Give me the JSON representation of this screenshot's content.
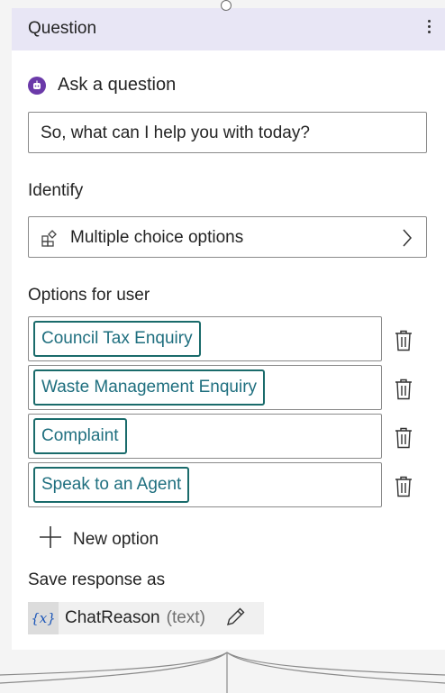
{
  "node": {
    "title": "Question",
    "menu_icon": "more-vertical-icon"
  },
  "ask": {
    "label": "Ask a question",
    "icon": "bot-icon",
    "question_text": "So, what can I help you with today?"
  },
  "identify": {
    "label": "Identify",
    "value": "Multiple choice options",
    "icon": "multiple-choice-icon"
  },
  "options": {
    "label": "Options for user",
    "items": [
      {
        "label": "Council Tax Enquiry"
      },
      {
        "label": "Waste Management Enquiry"
      },
      {
        "label": "Complaint"
      },
      {
        "label": "Speak to an Agent"
      }
    ],
    "new_option_label": "New option"
  },
  "save": {
    "label": "Save response as",
    "variable_icon": "{x}",
    "variable_name": "ChatReason",
    "variable_type": "(text)"
  },
  "colors": {
    "header_bg": "#e8e6f5",
    "chip_border": "#1a6b6b",
    "chip_text": "#1f6f7f",
    "bot_icon": "#6b3aa9",
    "variable_icon_text": "#1a55b8"
  }
}
